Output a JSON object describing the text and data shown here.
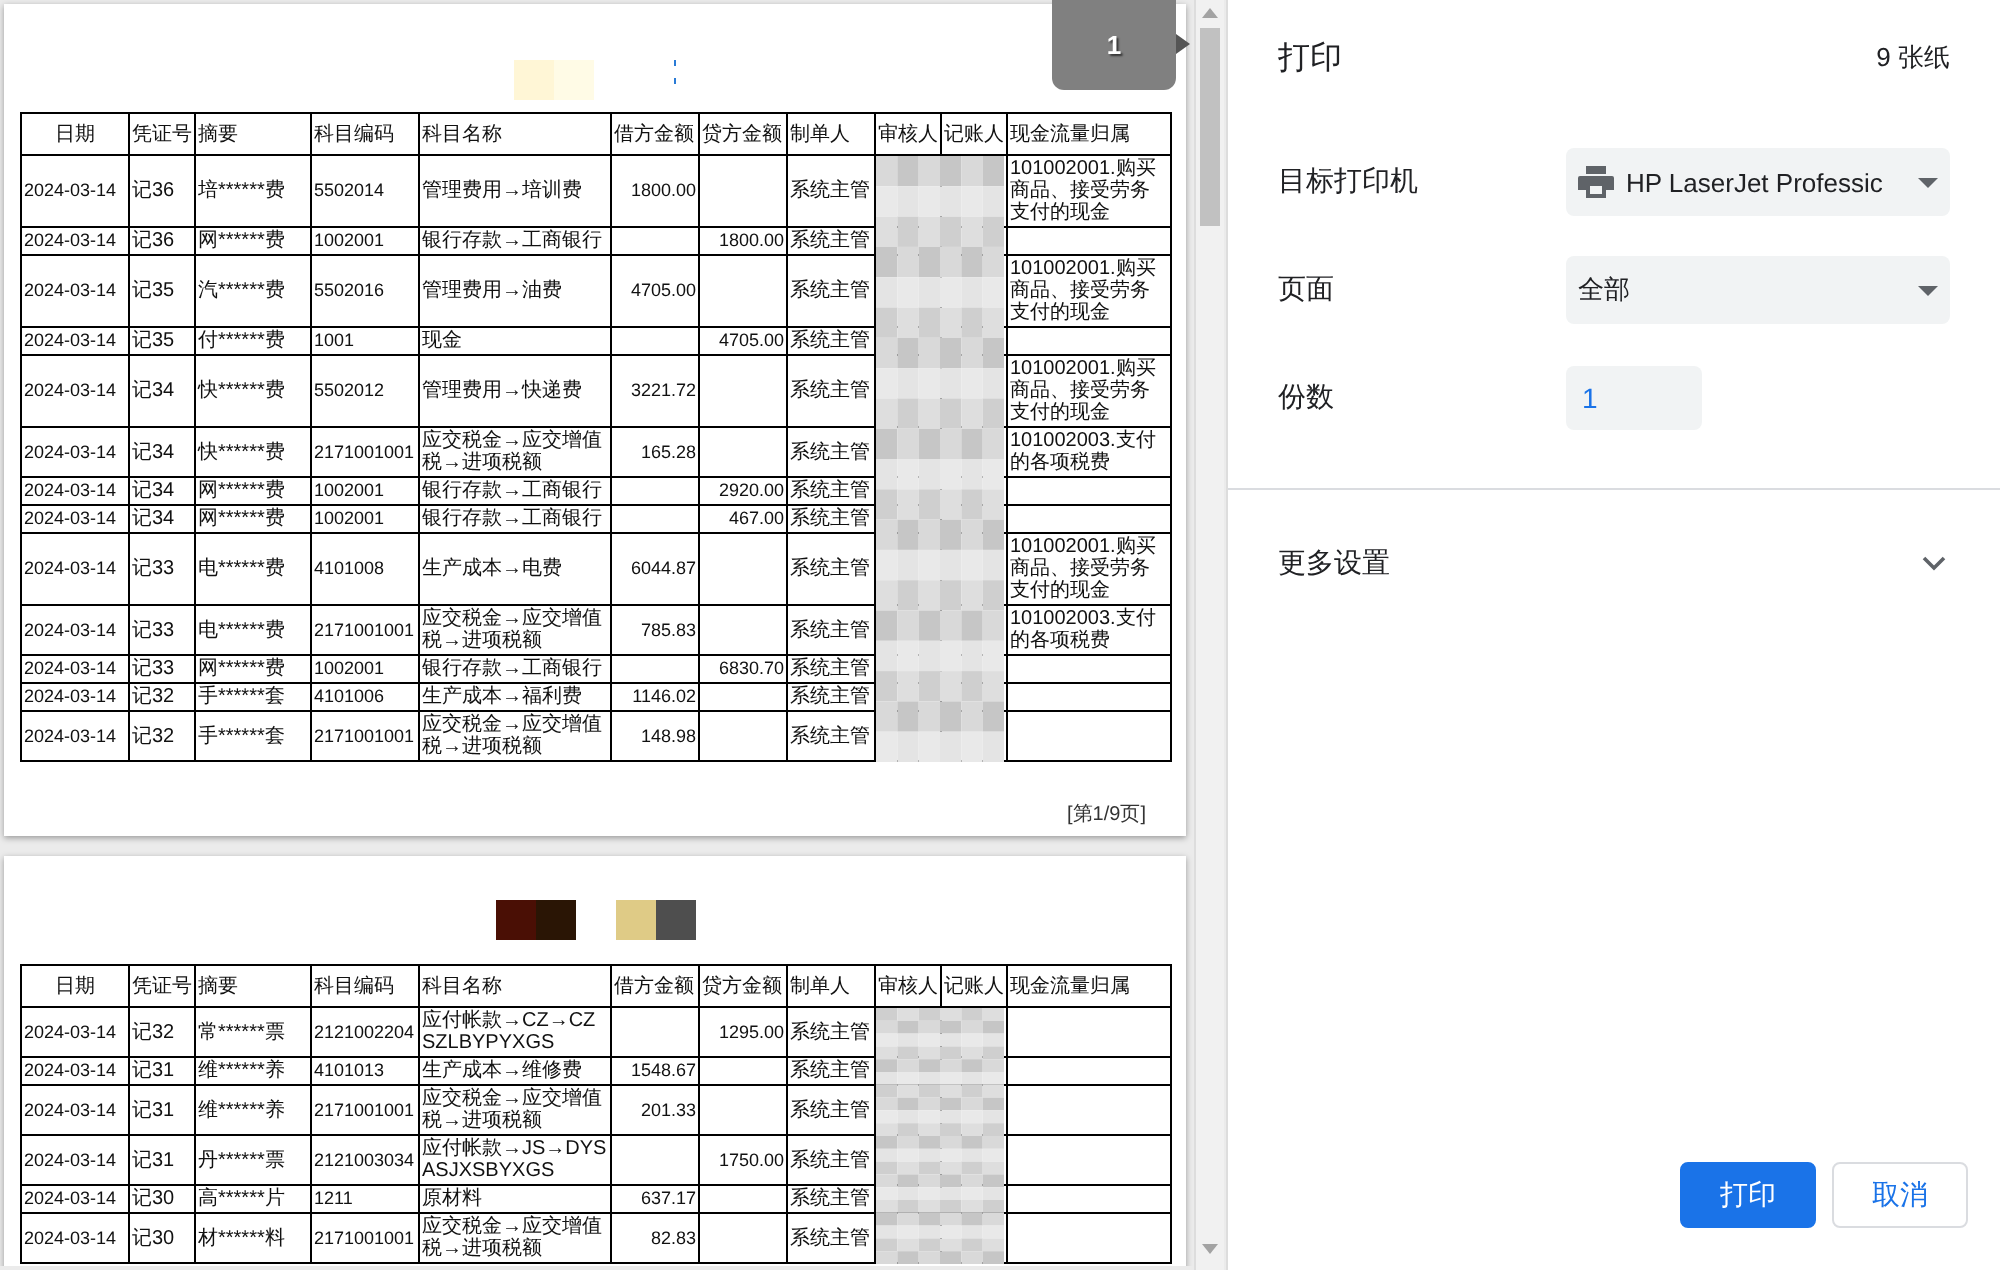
{
  "preview": {
    "page_badge": "1",
    "pages": [
      {
        "columns": [
          "日期",
          "凭证号",
          "摘要",
          "科目编码",
          "科目名称",
          "借方金额",
          "贷方金额",
          "制单人",
          "审核人",
          "记账人",
          "现金流量归属"
        ],
        "rows": [
          {
            "date": "2024-03-14",
            "voucher": "记36",
            "summary": "培******费",
            "code": "5502014",
            "account": "管理费用→培训费",
            "debit": "1800.00",
            "preparer": "系统主管",
            "cash_flow": "101002001.购买商品、接受劳务支付的现金"
          },
          {
            "date": "2024-03-14",
            "voucher": "记36",
            "summary": "网******费",
            "code": "1002001",
            "account": "银行存款→工商银行",
            "credit": "1800.00",
            "preparer": "系统主管"
          },
          {
            "date": "2024-03-14",
            "voucher": "记35",
            "summary": "汽******费",
            "code": "5502016",
            "account": "管理费用→油费",
            "debit": "4705.00",
            "preparer": "系统主管",
            "cash_flow": "101002001.购买商品、接受劳务支付的现金"
          },
          {
            "date": "2024-03-14",
            "voucher": "记35",
            "summary": "付******费",
            "code": "1001",
            "account": "现金",
            "credit": "4705.00",
            "preparer": "系统主管"
          },
          {
            "date": "2024-03-14",
            "voucher": "记34",
            "summary": "快******费",
            "code": "5502012",
            "account": "管理费用→快递费",
            "debit": "3221.72",
            "preparer": "系统主管",
            "cash_flow": "101002001.购买商品、接受劳务支付的现金"
          },
          {
            "date": "2024-03-14",
            "voucher": "记34",
            "summary": "快******费",
            "code": "2171001001",
            "account": "应交税金→应交增值税→进项税额",
            "debit": "165.28",
            "preparer": "系统主管",
            "cash_flow": "101002003.支付的各项税费"
          },
          {
            "date": "2024-03-14",
            "voucher": "记34",
            "summary": "网******费",
            "code": "1002001",
            "account": "银行存款→工商银行",
            "credit": "2920.00",
            "preparer": "系统主管"
          },
          {
            "date": "2024-03-14",
            "voucher": "记34",
            "summary": "网******费",
            "code": "1002001",
            "account": "银行存款→工商银行",
            "credit": "467.00",
            "preparer": "系统主管"
          },
          {
            "date": "2024-03-14",
            "voucher": "记33",
            "summary": "电******费",
            "code": "4101008",
            "account": "生产成本→电费",
            "debit": "6044.87",
            "preparer": "系统主管",
            "cash_flow": "101002001.购买商品、接受劳务支付的现金"
          },
          {
            "date": "2024-03-14",
            "voucher": "记33",
            "summary": "电******费",
            "code": "2171001001",
            "account": "应交税金→应交增值税→进项税额",
            "debit": "785.83",
            "preparer": "系统主管",
            "cash_flow": "101002003.支付的各项税费"
          },
          {
            "date": "2024-03-14",
            "voucher": "记33",
            "summary": "网******费",
            "code": "1002001",
            "account": "银行存款→工商银行",
            "credit": "6830.70",
            "preparer": "系统主管"
          },
          {
            "date": "2024-03-14",
            "voucher": "记32",
            "summary": "手******套",
            "code": "4101006",
            "account": "生产成本→福利费",
            "debit": "1146.02",
            "preparer": "系统主管"
          },
          {
            "date": "2024-03-14",
            "voucher": "记32",
            "summary": "手******套",
            "code": "2171001001",
            "account": "应交税金→应交增值税→进项税额",
            "debit": "148.98",
            "preparer": "系统主管"
          }
        ],
        "footer": "[第1/9页]"
      },
      {
        "columns": [
          "日期",
          "凭证号",
          "摘要",
          "科目编码",
          "科目名称",
          "借方金额",
          "贷方金额",
          "制单人",
          "审核人",
          "记账人",
          "现金流量归属"
        ],
        "rows": [
          {
            "date": "2024-03-14",
            "voucher": "记32",
            "summary": "常******票",
            "code": "2121002204",
            "account": "应付帐款→CZ→CZSZLBYPYXGS",
            "credit": "1295.00",
            "preparer": "系统主管"
          },
          {
            "date": "2024-03-14",
            "voucher": "记31",
            "summary": "维******养",
            "code": "4101013",
            "account": "生产成本→维修费",
            "debit": "1548.67",
            "preparer": "系统主管"
          },
          {
            "date": "2024-03-14",
            "voucher": "记31",
            "summary": "维******养",
            "code": "2171001001",
            "account": "应交税金→应交增值税→进项税额",
            "debit": "201.33",
            "preparer": "系统主管"
          },
          {
            "date": "2024-03-14",
            "voucher": "记31",
            "summary": "丹******票",
            "code": "2121003034",
            "account": "应付帐款→JS→DYSASJXSBYXGS",
            "credit": "1750.00",
            "preparer": "系统主管"
          },
          {
            "date": "2024-03-14",
            "voucher": "记30",
            "summary": "高******片",
            "code": "1211",
            "account": "原材料",
            "debit": "637.17",
            "preparer": "系统主管"
          },
          {
            "date": "2024-03-14",
            "voucher": "记30",
            "summary": "材******料",
            "code": "2171001001",
            "account": "应交税金→应交增值税→进项税额",
            "debit": "82.83",
            "preparer": "系统主管"
          }
        ]
      }
    ]
  },
  "settings": {
    "title": "打印",
    "sheet_count": "9 张纸",
    "fields": [
      {
        "kind": "device",
        "label": "目标打印机",
        "value": "HP LaserJet Professic"
      },
      {
        "kind": "select",
        "label": "页面",
        "value": "全部"
      },
      {
        "kind": "number",
        "label": "份数",
        "value": "1"
      }
    ],
    "more_settings": {
      "label": "更多设置",
      "expanded": false
    },
    "buttons": [
      {
        "kind": "primary",
        "label": "打印"
      },
      {
        "kind": "secondary",
        "label": "取消"
      }
    ]
  }
}
